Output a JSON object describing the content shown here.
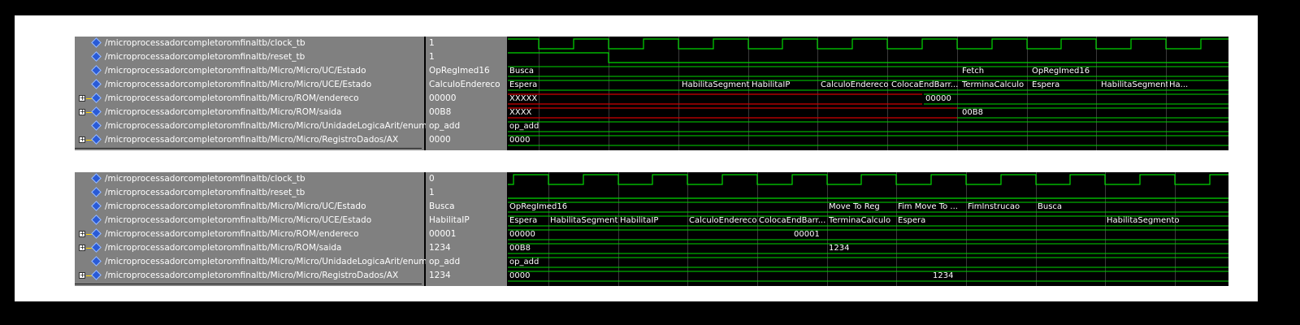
{
  "panels": [
    {
      "signals": [
        {
          "name": "/microprocessadorcompletoromfinaltb/clock_tb",
          "value": "1",
          "bus": false
        },
        {
          "name": "/microprocessadorcompletoromfinaltb/reset_tb",
          "value": "1",
          "bus": false
        },
        {
          "name": "/microprocessadorcompletoromfinaltb/Micro/Micro/UC/Estado",
          "value": "OpRegImed16",
          "bus": false
        },
        {
          "name": "/microprocessadorcompletoromfinaltb/Micro/Micro/UCE/Estado",
          "value": "CalculoEndereco",
          "bus": false
        },
        {
          "name": "/microprocessadorcompletoromfinaltb/Micro/ROM/endereco",
          "value": "00000",
          "bus": true
        },
        {
          "name": "/microprocessadorcompletoromfinaltb/Micro/ROM/saida",
          "value": "00B8",
          "bus": true
        },
        {
          "name": "/microprocessadorcompletoromfinaltb/Micro/Micro/UnidadeLogicaArit/enum_op",
          "value": "op_add",
          "bus": false
        },
        {
          "name": "/microprocessadorcompletoromfinaltb/Micro/Micro/RegistroDados/AX",
          "value": "0000",
          "bus": true
        }
      ],
      "wave_labels": [
        {
          "row": 2,
          "at": 0,
          "text": "Busca"
        },
        {
          "row": 2,
          "at": 557,
          "text": "Fetch"
        },
        {
          "row": 2,
          "at": 643,
          "text": "OpRegImed16"
        },
        {
          "row": 3,
          "at": 0,
          "text": "Espera"
        },
        {
          "row": 3,
          "at": 212,
          "text": "HabilitaSegmento"
        },
        {
          "row": 3,
          "at": 298,
          "text": "HabilitaIP"
        },
        {
          "row": 3,
          "at": 383,
          "text": "CalculoEndereco"
        },
        {
          "row": 3,
          "at": 470,
          "text": "ColocaEndBarr..."
        },
        {
          "row": 3,
          "at": 557,
          "text": "TerminaCalculo"
        },
        {
          "row": 3,
          "at": 643,
          "text": "Espera"
        },
        {
          "row": 3,
          "at": 728,
          "text": "HabilitaSegmento"
        },
        {
          "row": 3,
          "at": 812,
          "text": "Ha..."
        },
        {
          "row": 4,
          "at": 0,
          "text": "XXXXX"
        },
        {
          "row": 4,
          "at": 512,
          "text": "00000"
        },
        {
          "row": 5,
          "at": 0,
          "text": "XXXX"
        },
        {
          "row": 5,
          "at": 557,
          "text": "00B8"
        },
        {
          "row": 6,
          "at": 0,
          "text": "op_add"
        },
        {
          "row": 7,
          "at": 0,
          "text": "0000"
        }
      ]
    },
    {
      "signals": [
        {
          "name": "/microprocessadorcompletoromfinaltb/clock_tb",
          "value": "0",
          "bus": false
        },
        {
          "name": "/microprocessadorcompletoromfinaltb/reset_tb",
          "value": "1",
          "bus": false
        },
        {
          "name": "/microprocessadorcompletoromfinaltb/Micro/Micro/UC/Estado",
          "value": "Busca",
          "bus": false
        },
        {
          "name": "/microprocessadorcompletoromfinaltb/Micro/Micro/UCE/Estado",
          "value": "HabilitaIP",
          "bus": false
        },
        {
          "name": "/microprocessadorcompletoromfinaltb/Micro/ROM/endereco",
          "value": "00001",
          "bus": true
        },
        {
          "name": "/microprocessadorcompletoromfinaltb/Micro/ROM/saida",
          "value": "1234",
          "bus": true
        },
        {
          "name": "/microprocessadorcompletoromfinaltb/Micro/Micro/UnidadeLogicaArit/enum_op",
          "value": "op_add",
          "bus": false
        },
        {
          "name": "/microprocessadorcompletoromfinaltb/Micro/Micro/RegistroDados/AX",
          "value": "1234",
          "bus": true
        }
      ],
      "wave_labels": [
        {
          "row": 2,
          "at": 0,
          "text": "OpRegImed16"
        },
        {
          "row": 2,
          "at": 393,
          "text": "Move To Reg"
        },
        {
          "row": 2,
          "at": 478,
          "text": "Fim Move To ..."
        },
        {
          "row": 2,
          "at": 564,
          "text": "FimInstrucao"
        },
        {
          "row": 2,
          "at": 650,
          "text": "Busca"
        },
        {
          "row": 3,
          "at": 0,
          "text": "Espera"
        },
        {
          "row": 3,
          "at": 50,
          "text": "HabilitaSegmento"
        },
        {
          "row": 3,
          "at": 136,
          "text": "HabilitaIP"
        },
        {
          "row": 3,
          "at": 221,
          "text": "CalculoEndereco"
        },
        {
          "row": 3,
          "at": 307,
          "text": "ColocaEndBarr..."
        },
        {
          "row": 3,
          "at": 393,
          "text": "TerminaCalculo"
        },
        {
          "row": 3,
          "at": 478,
          "text": "Espera"
        },
        {
          "row": 3,
          "at": 735,
          "text": "HabilitaSegmento"
        },
        {
          "row": 4,
          "at": 0,
          "text": "00000"
        },
        {
          "row": 4,
          "at": 350,
          "text": "00001"
        },
        {
          "row": 5,
          "at": 0,
          "text": "00B8"
        },
        {
          "row": 5,
          "at": 393,
          "text": "1234"
        },
        {
          "row": 6,
          "at": 0,
          "text": "op_add"
        },
        {
          "row": 7,
          "at": 0,
          "text": "0000"
        },
        {
          "row": 7,
          "at": 521,
          "text": "1234"
        }
      ]
    }
  ],
  "colors": {
    "wave_green": "#00d800",
    "unknown_red": "#d00000",
    "grid": "#3a3a3a",
    "pane_gray": "#808080",
    "signal_icon": "#2a5bd7"
  }
}
